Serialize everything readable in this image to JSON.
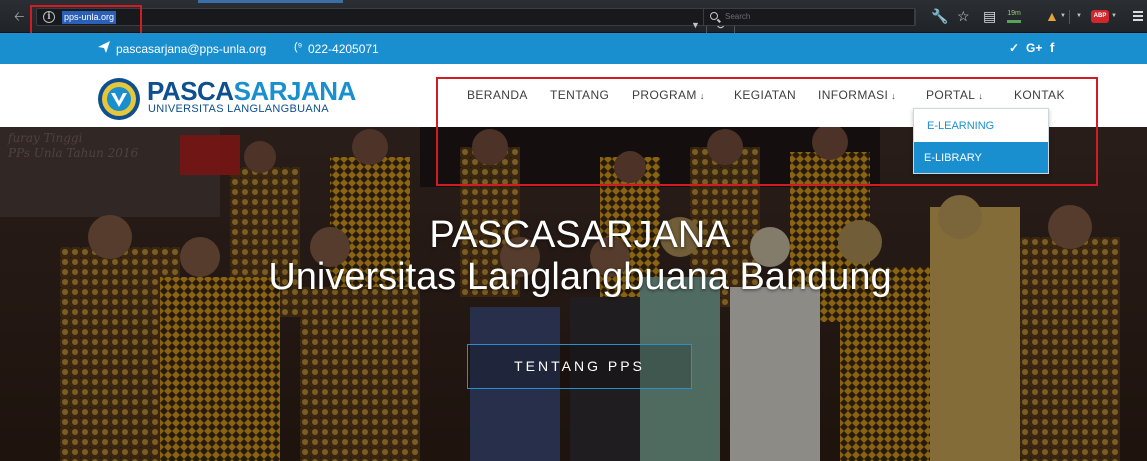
{
  "browser": {
    "url": "pps-unla.org",
    "search_placeholder": "Search",
    "clock_badge": "19m",
    "abp_label": "ABP"
  },
  "topbar": {
    "email": "pascasarjana@pps-unla.org",
    "phone_icon": "(⁹",
    "phone": "022-4205071",
    "social_twitter": "♥",
    "social_gplus": "G+",
    "social_facebook": "f"
  },
  "logo": {
    "title_part1": "PASCA",
    "title_part2": "SARJANA",
    "subtitle": "UNIVERSITAS LANGLANGBUANA"
  },
  "nav": {
    "beranda": "BERANDA",
    "tentang": "TENTANG",
    "program": "PROGRAM",
    "kegiatan": "KEGIATAN",
    "informasi": "INFORMASI",
    "portal": "PORTAL",
    "kontak": "KONTAK",
    "chevron": "»"
  },
  "portal_menu": {
    "elearning": "E-LEARNING",
    "elibrary": "E-LIBRARY"
  },
  "hero": {
    "title": "PASCASARJANA",
    "subtitle": "Universitas Langlangbuana Bandung",
    "button": "TENTANG PPS",
    "banner_line1": "furay Tinggi",
    "banner_line2": "PPs Unla Tahun 2016"
  },
  "colors": {
    "brand_blue": "#1a8fcf",
    "brand_navy": "#0e4f8f",
    "highlight_red": "#d11c24"
  }
}
